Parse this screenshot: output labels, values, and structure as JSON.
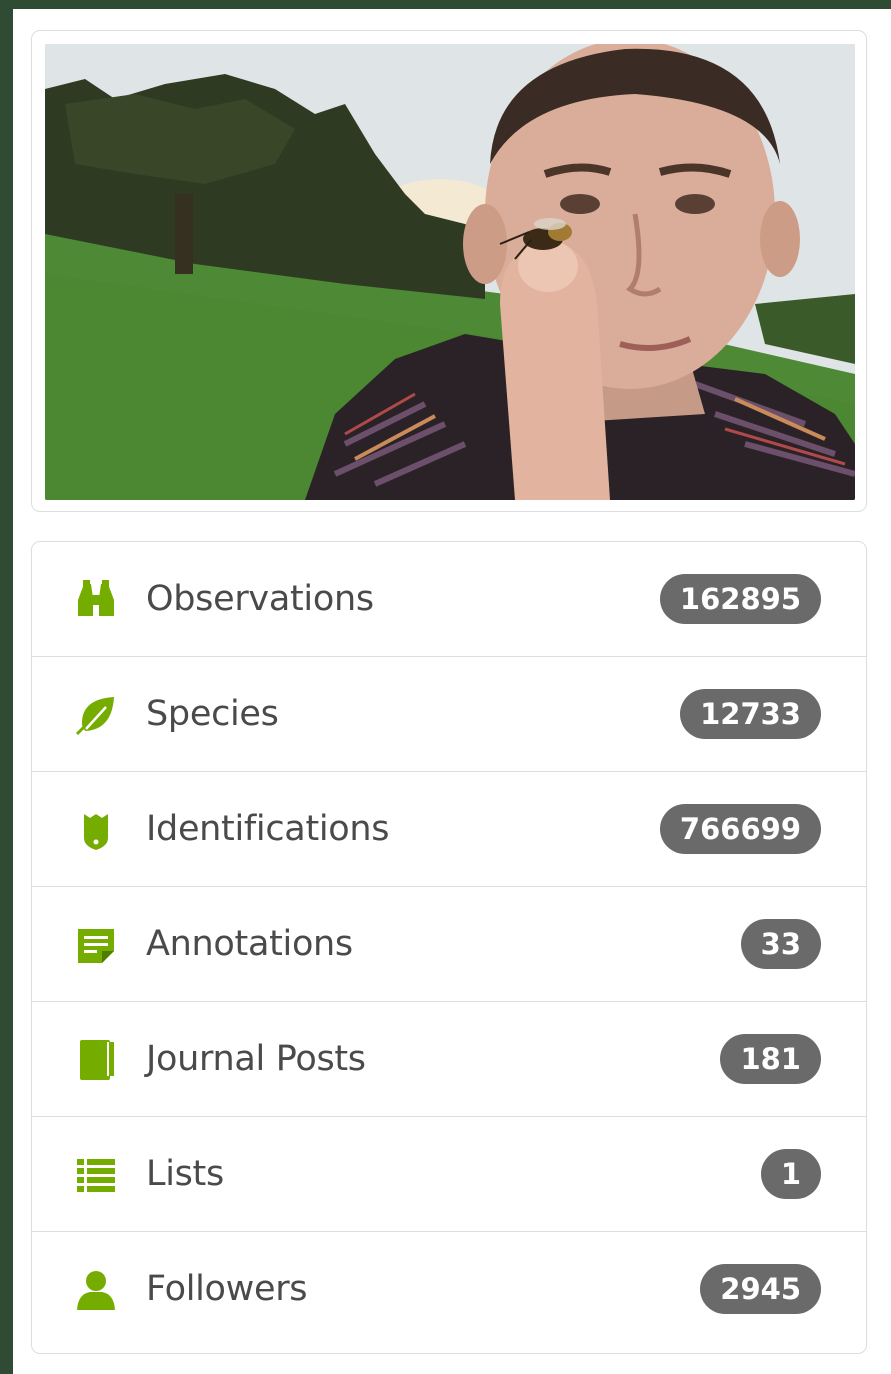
{
  "profile": {
    "photo_alt_icon": "profile-photo"
  },
  "colors": {
    "accent": "#74ac00",
    "badge": "#6a6a6a",
    "frame": "#2f4b33"
  },
  "stats": [
    {
      "label": "Observations",
      "count": "162895",
      "icon": "binoculars-icon"
    },
    {
      "label": "Species",
      "count": "12733",
      "icon": "leaf-icon"
    },
    {
      "label": "Identifications",
      "count": "766699",
      "icon": "badge-icon"
    },
    {
      "label": "Annotations",
      "count": "33",
      "icon": "annotation-icon"
    },
    {
      "label": "Journal Posts",
      "count": "181",
      "icon": "book-icon"
    },
    {
      "label": "Lists",
      "count": "1",
      "icon": "list-icon"
    },
    {
      "label": "Followers",
      "count": "2945",
      "icon": "user-icon"
    }
  ]
}
